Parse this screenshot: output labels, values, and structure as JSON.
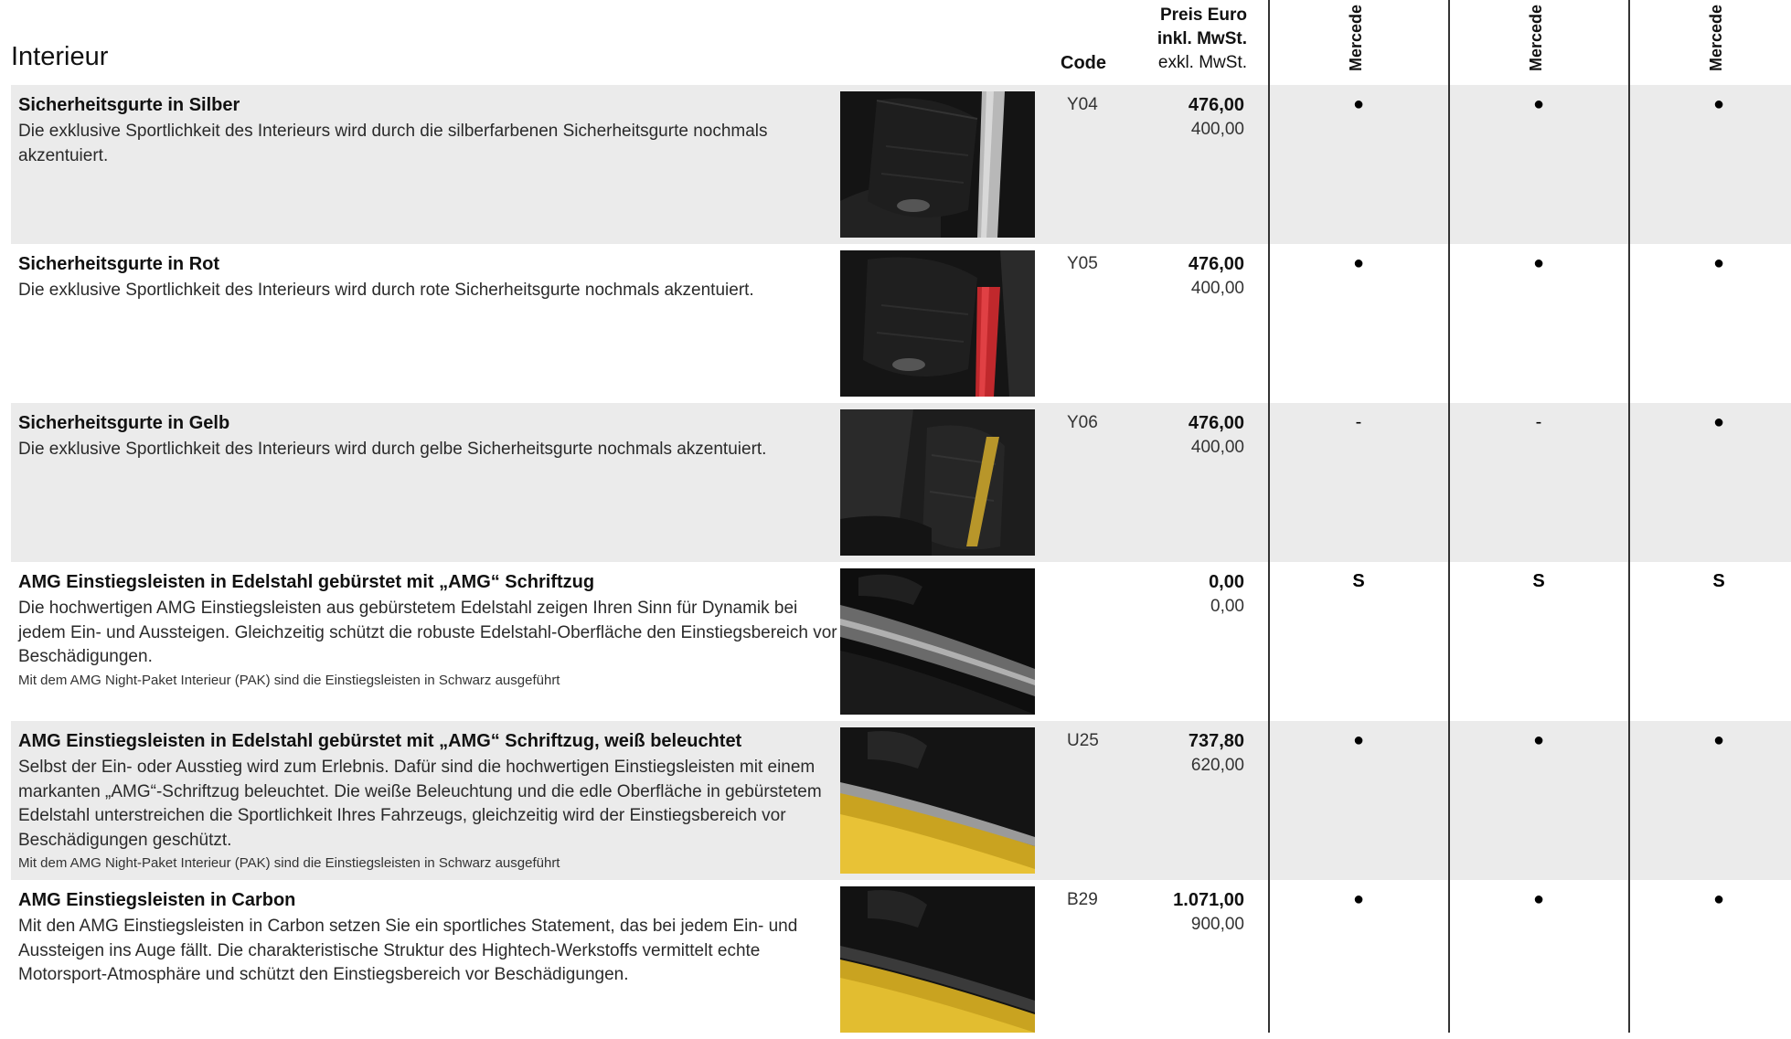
{
  "header": {
    "section_title": "Interieur",
    "code_label": "Code",
    "price_line1": "Preis Euro",
    "price_line2": "inkl. MwSt.",
    "price_line3": "exkl. MwSt.",
    "models": [
      "Mercede",
      "Mercede",
      "Mercede"
    ]
  },
  "colors": {
    "row_shade": "#ebebeb",
    "divider": "#333333"
  },
  "rows": [
    {
      "name": "Sicherheitsgurte in Silber",
      "desc": "Die exklusive Sportlichkeit des Interieurs wird durch die silberfarbenen Sicherheitsgurte nochmals akzentuiert.",
      "note": "",
      "code": "Y04",
      "price_incl": "476,00",
      "price_excl": "400,00",
      "m1": "●",
      "m2": "●",
      "m3": "●"
    },
    {
      "name": "Sicherheitsgurte in Rot",
      "desc": "Die exklusive Sportlichkeit des Interieurs wird durch rote Sicherheitsgurte nochmals akzentuiert.",
      "note": "",
      "code": "Y05",
      "price_incl": "476,00",
      "price_excl": "400,00",
      "m1": "●",
      "m2": "●",
      "m3": "●"
    },
    {
      "name": "Sicherheitsgurte in Gelb",
      "desc": "Die exklusive Sportlichkeit des Interieurs wird durch gelbe Sicherheitsgurte nochmals akzentuiert.",
      "note": "",
      "code": "Y06",
      "price_incl": "476,00",
      "price_excl": "400,00",
      "m1": "-",
      "m2": "-",
      "m3": "●"
    },
    {
      "name": "AMG Einstiegsleisten in Edelstahl gebürstet mit „AMG“ Schriftzug",
      "desc": "Die hochwertigen AMG Einstiegsleisten aus gebürstetem Edelstahl zeigen Ihren Sinn für Dynamik bei jedem Ein- und Aussteigen. Gleichzeitig schützt die robuste Edelstahl-Oberfläche den Einstiegsbereich vor Beschädigungen.",
      "note": "Mit dem AMG Night-Paket Interieur (PAK) sind die Einstiegsleisten in Schwarz ausgeführt",
      "code": "",
      "price_incl": "0,00",
      "price_excl": "0,00",
      "m1": "S",
      "m2": "S",
      "m3": "S"
    },
    {
      "name": "AMG Einstiegsleisten in Edelstahl gebürstet mit „AMG“ Schriftzug, weiß beleuchtet",
      "desc": "Selbst der Ein- oder Ausstieg wird zum Erlebnis. Dafür sind die hochwertigen Einstiegsleisten mit einem markanten „AMG“-Schriftzug beleuchtet. Die weiße Beleuchtung und die edle Oberfläche in gebürstetem Edelstahl unterstreichen die Sportlichkeit Ihres Fahrzeugs, gleichzeitig wird der Einstiegsbereich vor Beschädigungen geschützt.",
      "note": "Mit dem AMG Night-Paket Interieur (PAK) sind die Einstiegsleisten in Schwarz ausgeführt",
      "code": "U25",
      "price_incl": "737,80",
      "price_excl": "620,00",
      "m1": "●",
      "m2": "●",
      "m3": "●"
    },
    {
      "name": "AMG Einstiegsleisten in Carbon",
      "desc": "Mit den AMG Einstiegsleisten in Carbon setzen Sie ein sportliches Statement, das bei jedem Ein- und Aussteigen ins Auge fällt. Die charakteristische Struktur des Hightech-Werkstoffs vermittelt echte Motorsport-Atmosphäre und schützt den Einstiegsbereich vor Beschädigungen.",
      "note": "",
      "code": "B29",
      "price_incl": "1.071,00",
      "price_excl": "900,00",
      "m1": "●",
      "m2": "●",
      "m3": "●"
    }
  ]
}
